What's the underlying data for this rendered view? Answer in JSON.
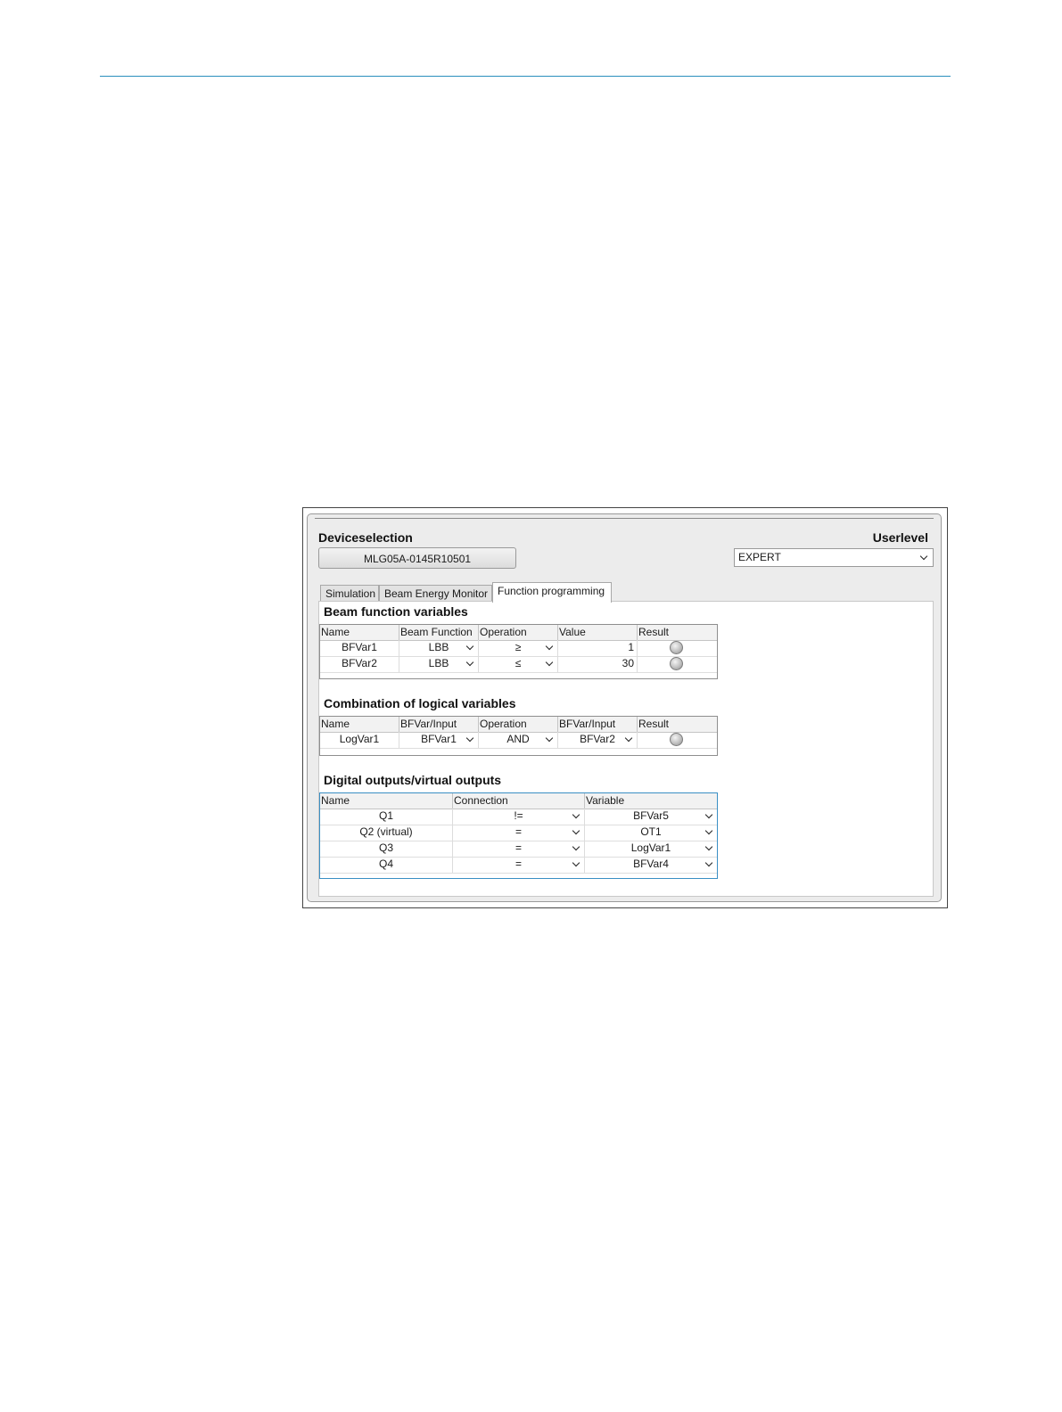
{
  "header": {
    "device_selection_label": "Deviceselection",
    "device_button": "MLG05A-0145R10501",
    "userlevel_label": "Userlevel",
    "userlevel_value": "EXPERT"
  },
  "tabs": [
    {
      "label": "Simulation",
      "active": false
    },
    {
      "label": "Beam Energy Monitor",
      "active": false
    },
    {
      "label": "Function programming",
      "active": true
    }
  ],
  "beam_function": {
    "title": "Beam function variables",
    "columns": [
      "Name",
      "Beam Function",
      "Operation",
      "Value",
      "Result"
    ],
    "rows": [
      {
        "name": "BFVar1",
        "function": "LBB",
        "operation": "≥",
        "value": "1",
        "result": "off"
      },
      {
        "name": "BFVar2",
        "function": "LBB",
        "operation": "≤",
        "value": "30",
        "result": "off"
      }
    ]
  },
  "logic": {
    "title": "Combination of logical variables",
    "columns": [
      "Name",
      "BFVar/Input",
      "Operation",
      "BFVar/Input",
      "Result"
    ],
    "rows": [
      {
        "name": "LogVar1",
        "input1": "BFVar1",
        "operation": "AND",
        "input2": "BFVar2",
        "result": "off"
      }
    ]
  },
  "outputs": {
    "title": "Digital outputs/virtual outputs",
    "columns": [
      "Name",
      "Connection",
      "Variable"
    ],
    "rows": [
      {
        "name": "Q1",
        "connection": "!=",
        "variable": "BFVar5"
      },
      {
        "name": "Q2 (virtual)",
        "connection": "=",
        "variable": "OT1"
      },
      {
        "name": "Q3",
        "connection": "=",
        "variable": "LogVar1"
      },
      {
        "name": "Q4",
        "connection": "=",
        "variable": "BFVar4"
      }
    ]
  },
  "colors": {
    "accent_rule": "#2a8fbd",
    "grid_focus": "#3a8fc4"
  }
}
